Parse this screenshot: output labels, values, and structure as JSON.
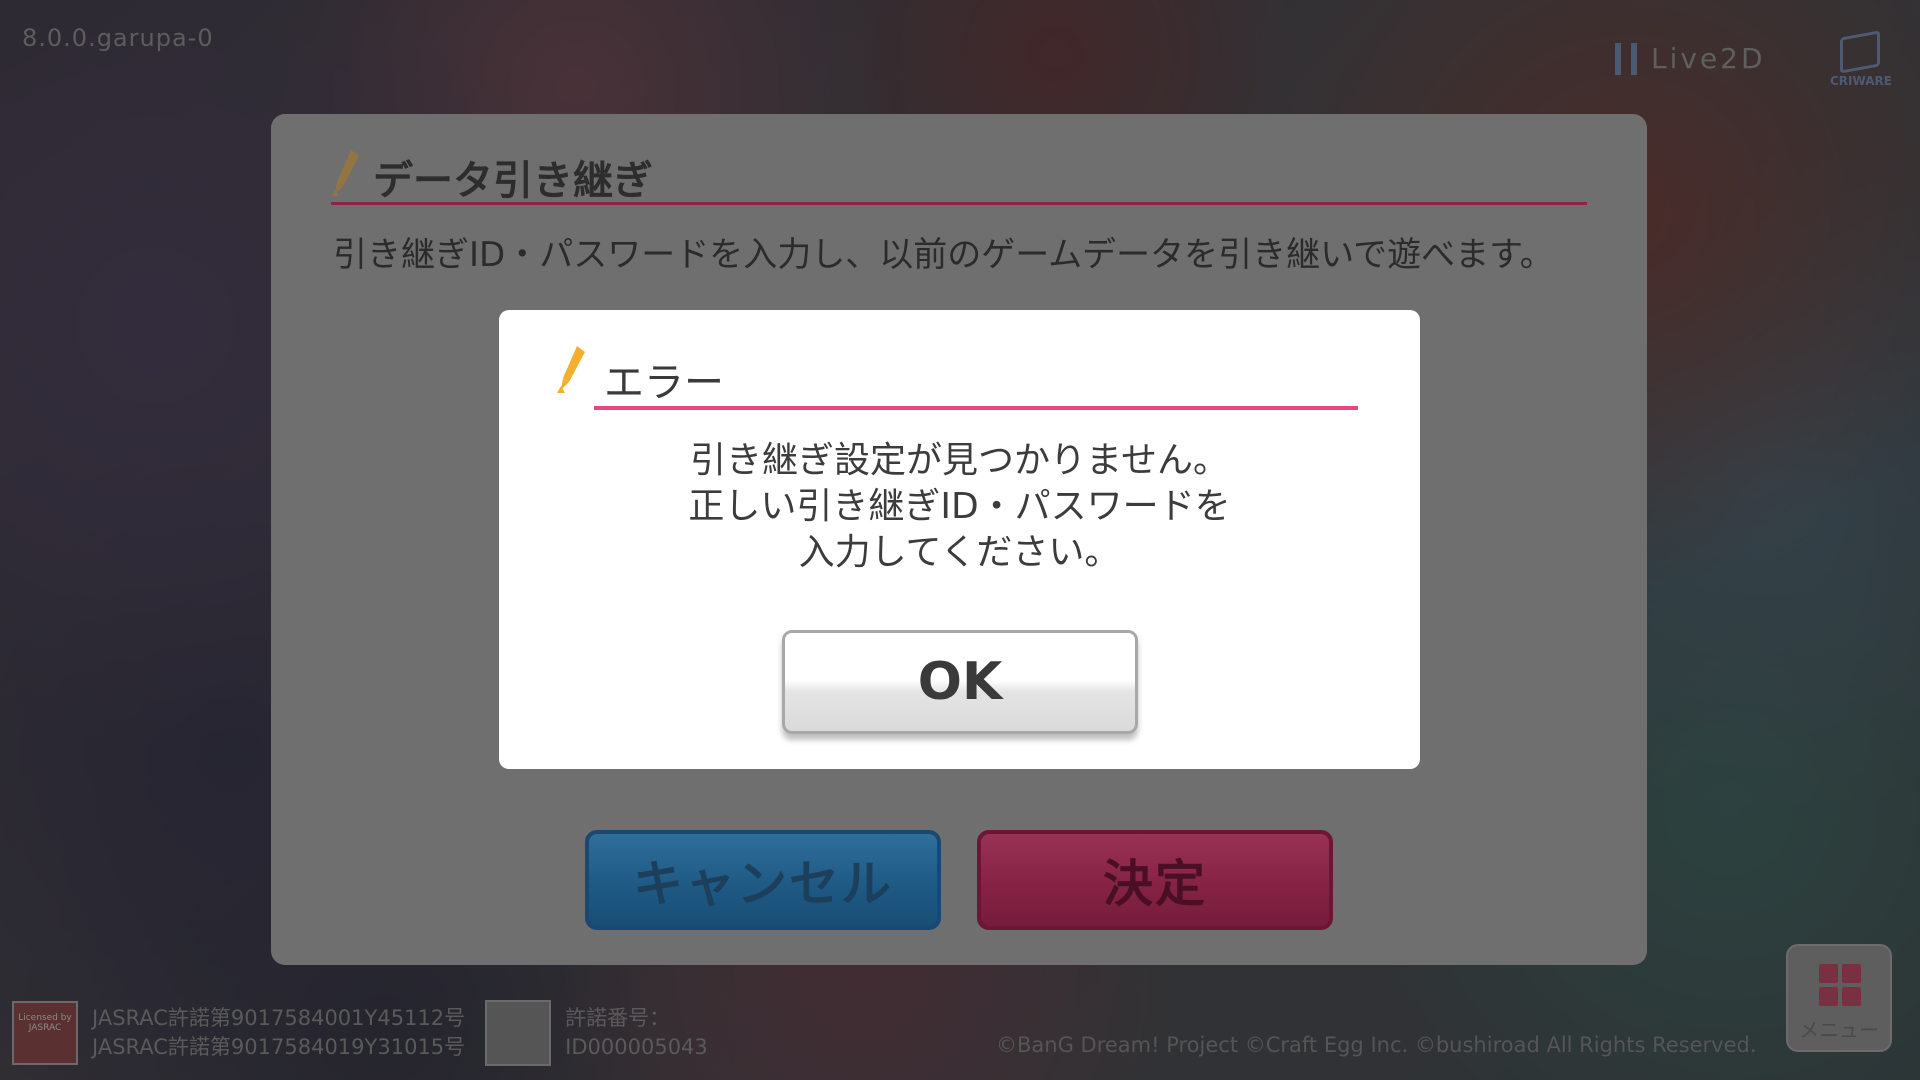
{
  "version": "8.0.0.garupa-0",
  "logos": {
    "live2d": "Live2D",
    "criware": "CRIWARE"
  },
  "transfer_dialog": {
    "title": "データ引き継ぎ",
    "description": "引き継ぎID・パスワードを入力し、以前のゲームデータを引き継いで遊べます。",
    "cancel_label": "キャンセル",
    "confirm_label": "決定"
  },
  "error_dialog": {
    "title": "エラー",
    "message_lines": [
      "引き継ぎ設定が見つかりません。",
      "正しい引き継ぎID・パスワードを",
      "入力してください。"
    ],
    "ok_label": "OK"
  },
  "footer": {
    "jasrac_lines": [
      "JASRAC許諾第9017584001Y45112号",
      "JASRAC許諾第9017584019Y31015号"
    ],
    "permit_lines": [
      "許諾番号：",
      "ID000005043"
    ],
    "copyright": "©BanG Dream! Project ©Craft Egg Inc. ©bushiroad All Rights Reserved.",
    "menu_label": "メニュー"
  },
  "colors": {
    "accent_pink": "#e8457a",
    "cancel_blue": "#2f6f9a",
    "confirm_pink": "#983254"
  }
}
